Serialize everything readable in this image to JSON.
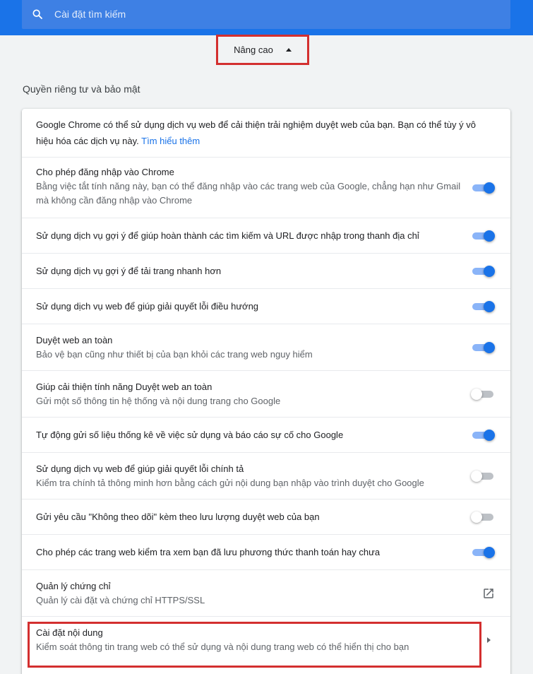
{
  "search": {
    "placeholder": "Cài đặt tìm kiếm",
    "value": ""
  },
  "advanced": {
    "label": "Nâng cao"
  },
  "section": {
    "title": "Quyền riêng tư và bảo mật"
  },
  "intro": {
    "text": "Google Chrome có thể sử dụng dịch vụ web để cải thiện trải nghiệm duyệt web của bạn. Bạn có thể tùy ý vô hiệu hóa các dịch vụ này.",
    "link": "Tìm hiểu thêm"
  },
  "settings": [
    {
      "label": "Cho phép đăng nhập vào Chrome",
      "sub": "Bằng việc tắt tính năng này, bạn có thể đăng nhập vào các trang web của Google, chẳng hạn như Gmail mà không cần đăng nhập vào Chrome",
      "enabled": true
    },
    {
      "label": "Sử dụng dịch vụ gợi ý để giúp hoàn thành các tìm kiếm và URL được nhập trong thanh địa chỉ",
      "enabled": true
    },
    {
      "label": "Sử dụng dịch vụ gợi ý để tải trang nhanh hơn",
      "enabled": true
    },
    {
      "label": "Sử dụng dịch vụ web để giúp giải quyết lỗi điều hướng",
      "enabled": true
    },
    {
      "label": "Duyệt web an toàn",
      "sub": "Bảo vệ bạn cũng như thiết bị của bạn khỏi các trang web nguy hiểm",
      "enabled": true
    },
    {
      "label": "Giúp cải thiện tính năng Duyệt web an toàn",
      "sub": "Gửi một số thông tin hệ thống và nội dung trang cho Google",
      "enabled": false
    },
    {
      "label": "Tự động gửi số liệu thống kê về việc sử dụng và báo cáo sự cố cho Google",
      "enabled": true
    },
    {
      "label": "Sử dụng dịch vụ web để giúp giải quyết lỗi chính tả",
      "sub": "Kiểm tra chính tả thông minh hơn bằng cách gửi nội dung bạn nhập vào trình duyệt cho Google",
      "enabled": false
    },
    {
      "label": "Gửi yêu cầu \"Không theo dõi\" kèm theo lưu lượng duyệt web của bạn",
      "enabled": false
    },
    {
      "label": "Cho phép các trang web kiểm tra xem bạn đã lưu phương thức thanh toán hay chưa",
      "enabled": true
    }
  ],
  "certificates": {
    "label": "Quản lý chứng chỉ",
    "sub": "Quản lý cài đặt và chứng chỉ HTTPS/SSL",
    "icon": "open-in-new-icon"
  },
  "content_settings": {
    "label": "Cài đặt nội dung",
    "sub": "Kiểm soát thông tin trang web có thể sử dụng và nội dung trang web có thể hiển thị cho bạn",
    "icon": "arrow-right-icon"
  },
  "colors": {
    "accent": "#1a73e8",
    "highlight": "#d32f2f"
  }
}
